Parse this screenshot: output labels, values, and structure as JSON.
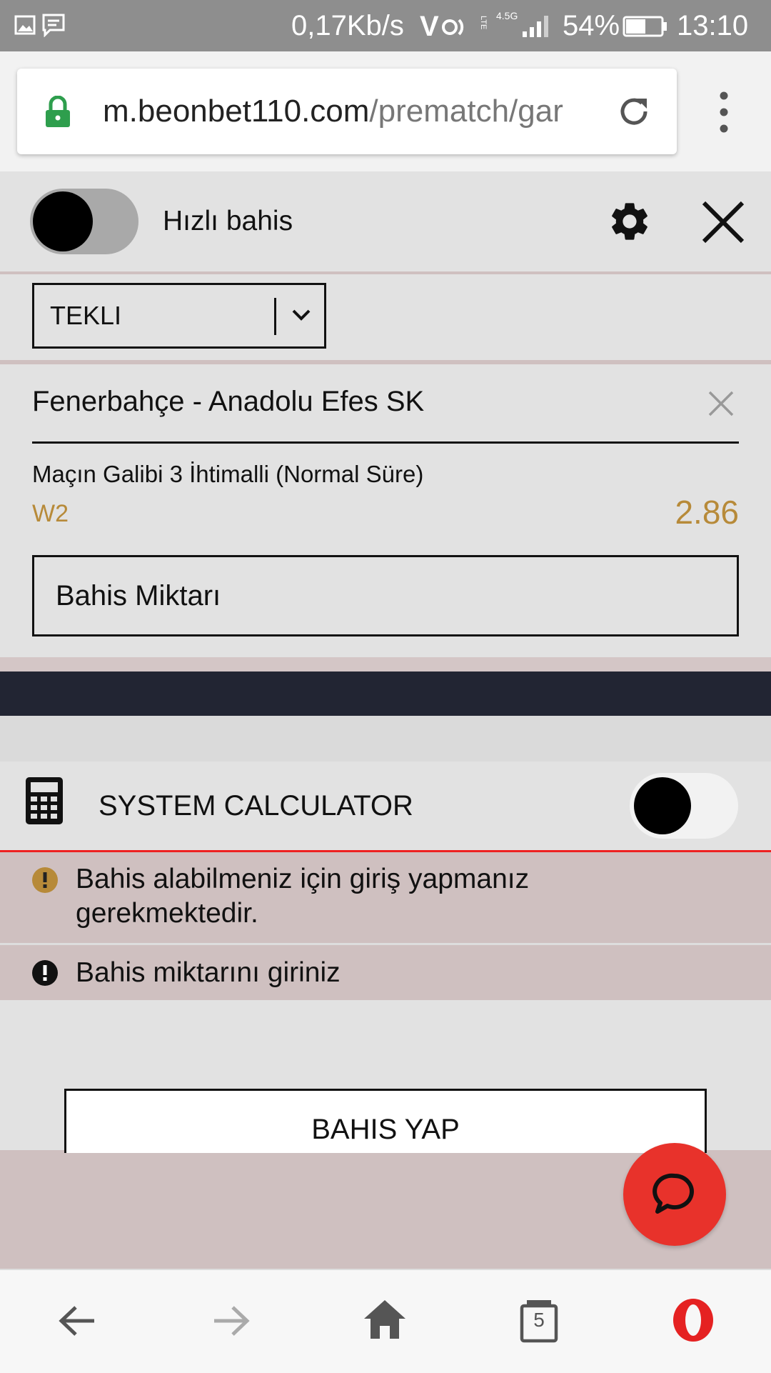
{
  "status_bar": {
    "network_speed": "0,17Kb/s",
    "network_type": "4.5G",
    "battery": "54%",
    "time": "13:10",
    "icons": [
      "image-icon",
      "message-icon",
      "volte-icon",
      "lte-icon",
      "signal-icon",
      "battery-icon"
    ]
  },
  "browser": {
    "url_domain": "m.beonbet110.com",
    "url_path": "/prematch/gar",
    "icons": [
      "lock-icon",
      "reload-icon",
      "more-icon"
    ]
  },
  "quick_bet": {
    "label": "Hızlı bahis",
    "enabled": false
  },
  "bet_type": {
    "selected": "TEKLI"
  },
  "bet": {
    "match": "Fenerbahçe - Anadolu Efes SK",
    "market": "Maçın Galibi 3 İhtimalli (Normal Süre)",
    "pick": "W2",
    "odds": "2.86",
    "stake_placeholder": "Bahis Miktarı"
  },
  "system_calculator": {
    "label": "SYSTEM CALCULATOR",
    "enabled": false
  },
  "messages": [
    {
      "text": "Bahis alabilmeniz için giriş yapmanız gerekmektedir.",
      "type": "warning"
    },
    {
      "text": "Bahis miktarını giriniz",
      "type": "error"
    }
  ],
  "place_bet_label": "BAHIS YAP",
  "nav": {
    "tabs_count": "5"
  },
  "colors": {
    "accent_odds": "#b78a39",
    "chat": "#e8322b",
    "dark_bar": "#222533",
    "lock": "#2e9e4d"
  }
}
